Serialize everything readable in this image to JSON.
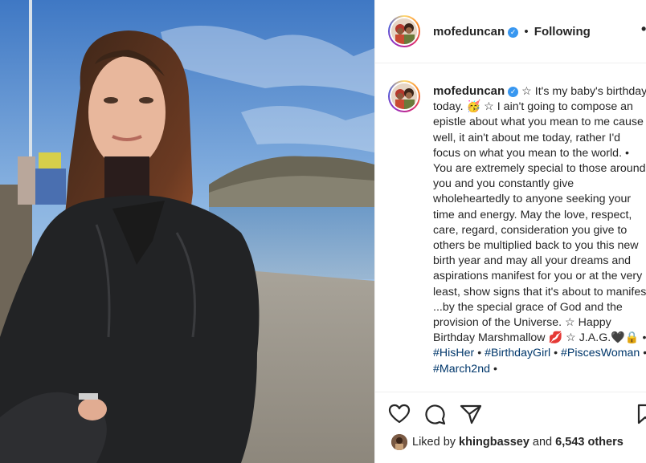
{
  "post": {
    "username": "mofeduncan",
    "verified_icon": "verified-badge-icon",
    "follow_separator": "•",
    "follow_status": "Following",
    "more_label": "•",
    "caption": {
      "username": "mofeduncan",
      "body": "☆ It's my baby's birthday today. 🥳 ☆ I ain't going to compose an epistle about what you mean to me cause well, it ain't about me today, rather I'd focus on what you mean to the world. • You are extremely special to those around you and you constantly give wholeheartedly to anyone seeking your time and energy. May the love, respect, care, regard, consideration you give to others be multiplied back to you this new birth year and may all your dreams and aspirations manifest for you or at the very least, show signs that it's about to manifest ...by the special grace of God and the provision of the Universe. ☆ Happy Birthday Marshmallow 💋 ☆ J.A.G.🖤🔒 •",
      "tags": [
        "#HisHer",
        "#BirthdayGirl",
        "#PiscesWoman",
        "#March2nd"
      ],
      "tag_separator": "•",
      "trailing": "•"
    },
    "likes": {
      "prefix": "Liked by",
      "user": "khingbassey",
      "middle": "and",
      "count": "6,543 others"
    }
  },
  "icons": [
    "heart-icon",
    "comment-icon",
    "share-icon",
    "bookmark-icon"
  ]
}
